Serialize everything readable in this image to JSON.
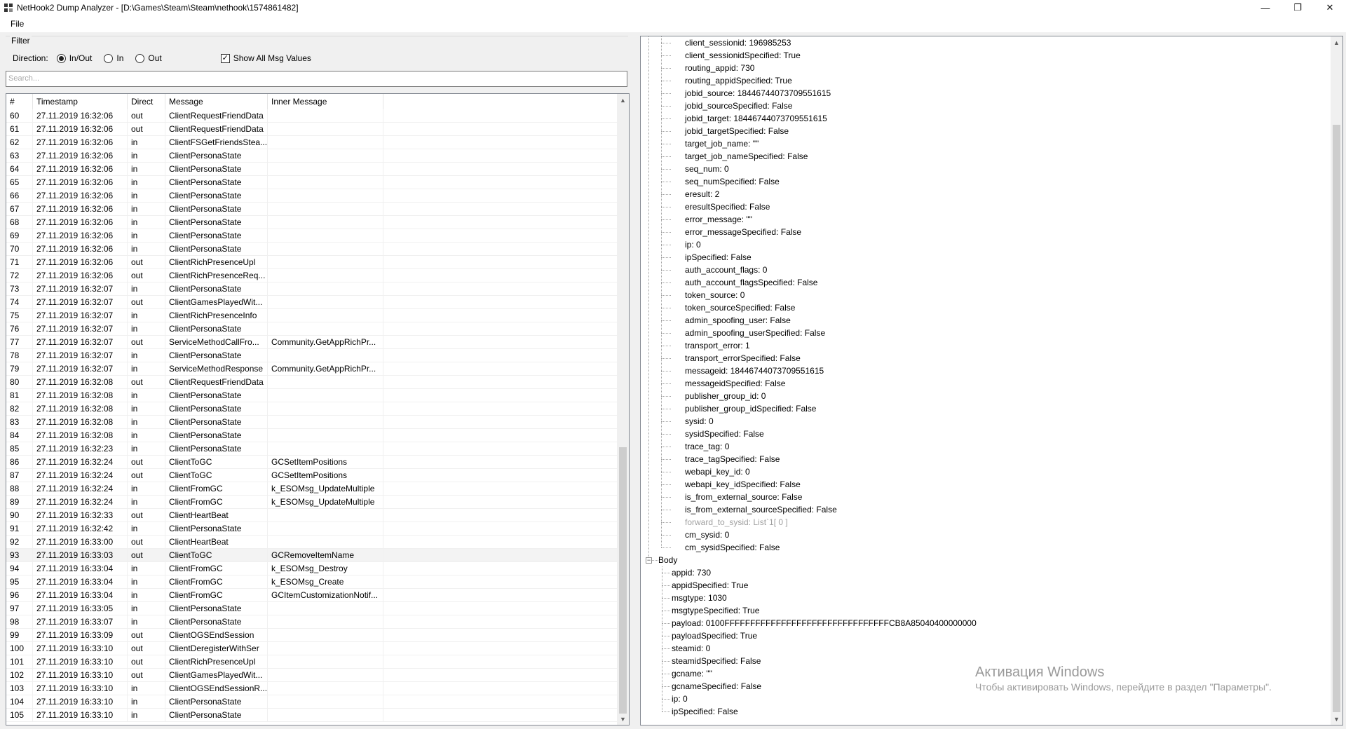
{
  "window": {
    "title": "NetHook2 Dump Analyzer - [D:\\Games\\Steam\\Steam\\nethook\\1574861482]",
    "minimize": "—",
    "maximize": "❐",
    "close": "✕"
  },
  "menu": {
    "file": "File"
  },
  "filter": {
    "legend": "Filter",
    "direction_label": "Direction:",
    "options": [
      "In/Out",
      "In",
      "Out"
    ],
    "selected": "In/Out",
    "show_all_label": "Show All Msg Values",
    "show_all_checked": true
  },
  "search": {
    "placeholder": "Search..."
  },
  "table": {
    "columns": [
      "#",
      "Timestamp",
      "Direct",
      "Message",
      "Inner Message"
    ],
    "selected_row": "93",
    "rows": [
      [
        "60",
        "27.11.2019 16:32:06",
        "out",
        "ClientRequestFriendData",
        ""
      ],
      [
        "61",
        "27.11.2019 16:32:06",
        "out",
        "ClientRequestFriendData",
        ""
      ],
      [
        "62",
        "27.11.2019 16:32:06",
        "in",
        "ClientFSGetFriendsStea...",
        ""
      ],
      [
        "63",
        "27.11.2019 16:32:06",
        "in",
        "ClientPersonaState",
        ""
      ],
      [
        "64",
        "27.11.2019 16:32:06",
        "in",
        "ClientPersonaState",
        ""
      ],
      [
        "65",
        "27.11.2019 16:32:06",
        "in",
        "ClientPersonaState",
        ""
      ],
      [
        "66",
        "27.11.2019 16:32:06",
        "in",
        "ClientPersonaState",
        ""
      ],
      [
        "67",
        "27.11.2019 16:32:06",
        "in",
        "ClientPersonaState",
        ""
      ],
      [
        "68",
        "27.11.2019 16:32:06",
        "in",
        "ClientPersonaState",
        ""
      ],
      [
        "69",
        "27.11.2019 16:32:06",
        "in",
        "ClientPersonaState",
        ""
      ],
      [
        "70",
        "27.11.2019 16:32:06",
        "in",
        "ClientPersonaState",
        ""
      ],
      [
        "71",
        "27.11.2019 16:32:06",
        "out",
        "ClientRichPresenceUpl",
        ""
      ],
      [
        "72",
        "27.11.2019 16:32:06",
        "out",
        "ClientRichPresenceReq...",
        ""
      ],
      [
        "73",
        "27.11.2019 16:32:07",
        "in",
        "ClientPersonaState",
        ""
      ],
      [
        "74",
        "27.11.2019 16:32:07",
        "out",
        "ClientGamesPlayedWit...",
        ""
      ],
      [
        "75",
        "27.11.2019 16:32:07",
        "in",
        "ClientRichPresenceInfo",
        ""
      ],
      [
        "76",
        "27.11.2019 16:32:07",
        "in",
        "ClientPersonaState",
        ""
      ],
      [
        "77",
        "27.11.2019 16:32:07",
        "out",
        "ServiceMethodCallFro...",
        "Community.GetAppRichPr..."
      ],
      [
        "78",
        "27.11.2019 16:32:07",
        "in",
        "ClientPersonaState",
        ""
      ],
      [
        "79",
        "27.11.2019 16:32:07",
        "in",
        "ServiceMethodResponse",
        "Community.GetAppRichPr..."
      ],
      [
        "80",
        "27.11.2019 16:32:08",
        "out",
        "ClientRequestFriendData",
        ""
      ],
      [
        "81",
        "27.11.2019 16:32:08",
        "in",
        "ClientPersonaState",
        ""
      ],
      [
        "82",
        "27.11.2019 16:32:08",
        "in",
        "ClientPersonaState",
        ""
      ],
      [
        "83",
        "27.11.2019 16:32:08",
        "in",
        "ClientPersonaState",
        ""
      ],
      [
        "84",
        "27.11.2019 16:32:08",
        "in",
        "ClientPersonaState",
        ""
      ],
      [
        "85",
        "27.11.2019 16:32:23",
        "in",
        "ClientPersonaState",
        ""
      ],
      [
        "86",
        "27.11.2019 16:32:24",
        "out",
        "ClientToGC",
        "GCSetItemPositions"
      ],
      [
        "87",
        "27.11.2019 16:32:24",
        "out",
        "ClientToGC",
        "GCSetItemPositions"
      ],
      [
        "88",
        "27.11.2019 16:32:24",
        "in",
        "ClientFromGC",
        "k_ESOMsg_UpdateMultiple"
      ],
      [
        "89",
        "27.11.2019 16:32:24",
        "in",
        "ClientFromGC",
        "k_ESOMsg_UpdateMultiple"
      ],
      [
        "90",
        "27.11.2019 16:32:33",
        "out",
        "ClientHeartBeat",
        ""
      ],
      [
        "91",
        "27.11.2019 16:32:42",
        "in",
        "ClientPersonaState",
        ""
      ],
      [
        "92",
        "27.11.2019 16:33:00",
        "out",
        "ClientHeartBeat",
        ""
      ],
      [
        "93",
        "27.11.2019 16:33:03",
        "out",
        "ClientToGC",
        "GCRemoveItemName"
      ],
      [
        "94",
        "27.11.2019 16:33:04",
        "in",
        "ClientFromGC",
        "k_ESOMsg_Destroy"
      ],
      [
        "95",
        "27.11.2019 16:33:04",
        "in",
        "ClientFromGC",
        "k_ESOMsg_Create"
      ],
      [
        "96",
        "27.11.2019 16:33:04",
        "in",
        "ClientFromGC",
        "GCItemCustomizationNotif..."
      ],
      [
        "97",
        "27.11.2019 16:33:05",
        "in",
        "ClientPersonaState",
        ""
      ],
      [
        "98",
        "27.11.2019 16:33:07",
        "in",
        "ClientPersonaState",
        ""
      ],
      [
        "99",
        "27.11.2019 16:33:09",
        "out",
        "ClientOGSEndSession",
        ""
      ],
      [
        "100",
        "27.11.2019 16:33:10",
        "out",
        "ClientDeregisterWithSer",
        ""
      ],
      [
        "101",
        "27.11.2019 16:33:10",
        "out",
        "ClientRichPresenceUpl",
        ""
      ],
      [
        "102",
        "27.11.2019 16:33:10",
        "out",
        "ClientGamesPlayedWit...",
        ""
      ],
      [
        "103",
        "27.11.2019 16:33:10",
        "in",
        "ClientOGSEndSessionR...",
        ""
      ],
      [
        "104",
        "27.11.2019 16:33:10",
        "in",
        "ClientPersonaState",
        ""
      ],
      [
        "105",
        "27.11.2019 16:33:10",
        "in",
        "ClientPersonaState",
        ""
      ]
    ]
  },
  "tree": {
    "header_fields": [
      "client_sessionid: 196985253",
      "client_sessionidSpecified: True",
      "routing_appid: 730",
      "routing_appidSpecified: True",
      "jobid_source: 18446744073709551615",
      "jobid_sourceSpecified: False",
      "jobid_target: 18446744073709551615",
      "jobid_targetSpecified: False",
      "target_job_name: \"\"",
      "target_job_nameSpecified: False",
      "seq_num: 0",
      "seq_numSpecified: False",
      "eresult: 2",
      "eresultSpecified: False",
      "error_message: \"\"",
      "error_messageSpecified: False",
      "ip: 0",
      "ipSpecified: False",
      "auth_account_flags: 0",
      "auth_account_flagsSpecified: False",
      "token_source: 0",
      "token_sourceSpecified: False",
      "admin_spoofing_user: False",
      "admin_spoofing_userSpecified: False",
      "transport_error: 1",
      "transport_errorSpecified: False",
      "messageid: 18446744073709551615",
      "messageidSpecified: False",
      "publisher_group_id: 0",
      "publisher_group_idSpecified: False",
      "sysid: 0",
      "sysidSpecified: False",
      "trace_tag: 0",
      "trace_tagSpecified: False",
      "webapi_key_id: 0",
      "webapi_key_idSpecified: False",
      "is_from_external_source: False",
      "is_from_external_sourceSpecified: False",
      "forward_to_sysid: List`1[ 0 ]",
      "cm_sysid: 0",
      "cm_sysidSpecified: False"
    ],
    "gray_index": 38,
    "body_label": "Body",
    "body_expander": "−",
    "body_fields": [
      "appid: 730",
      "appidSpecified: True",
      "msgtype: 1030",
      "msgtypeSpecified: True",
      "payload: 0100FFFFFFFFFFFFFFFFFFFFFFFFFFFFFFFFCB8A85040400000000",
      "payloadSpecified: True",
      "steamid: 0",
      "steamidSpecified: False",
      "gcname: \"\"",
      "gcnameSpecified: False",
      "ip: 0",
      "ipSpecified: False"
    ]
  },
  "watermark": {
    "line1": "Активация Windows",
    "line2": "Чтобы активировать Windows, перейдите в раздел \"Параметры\"."
  }
}
